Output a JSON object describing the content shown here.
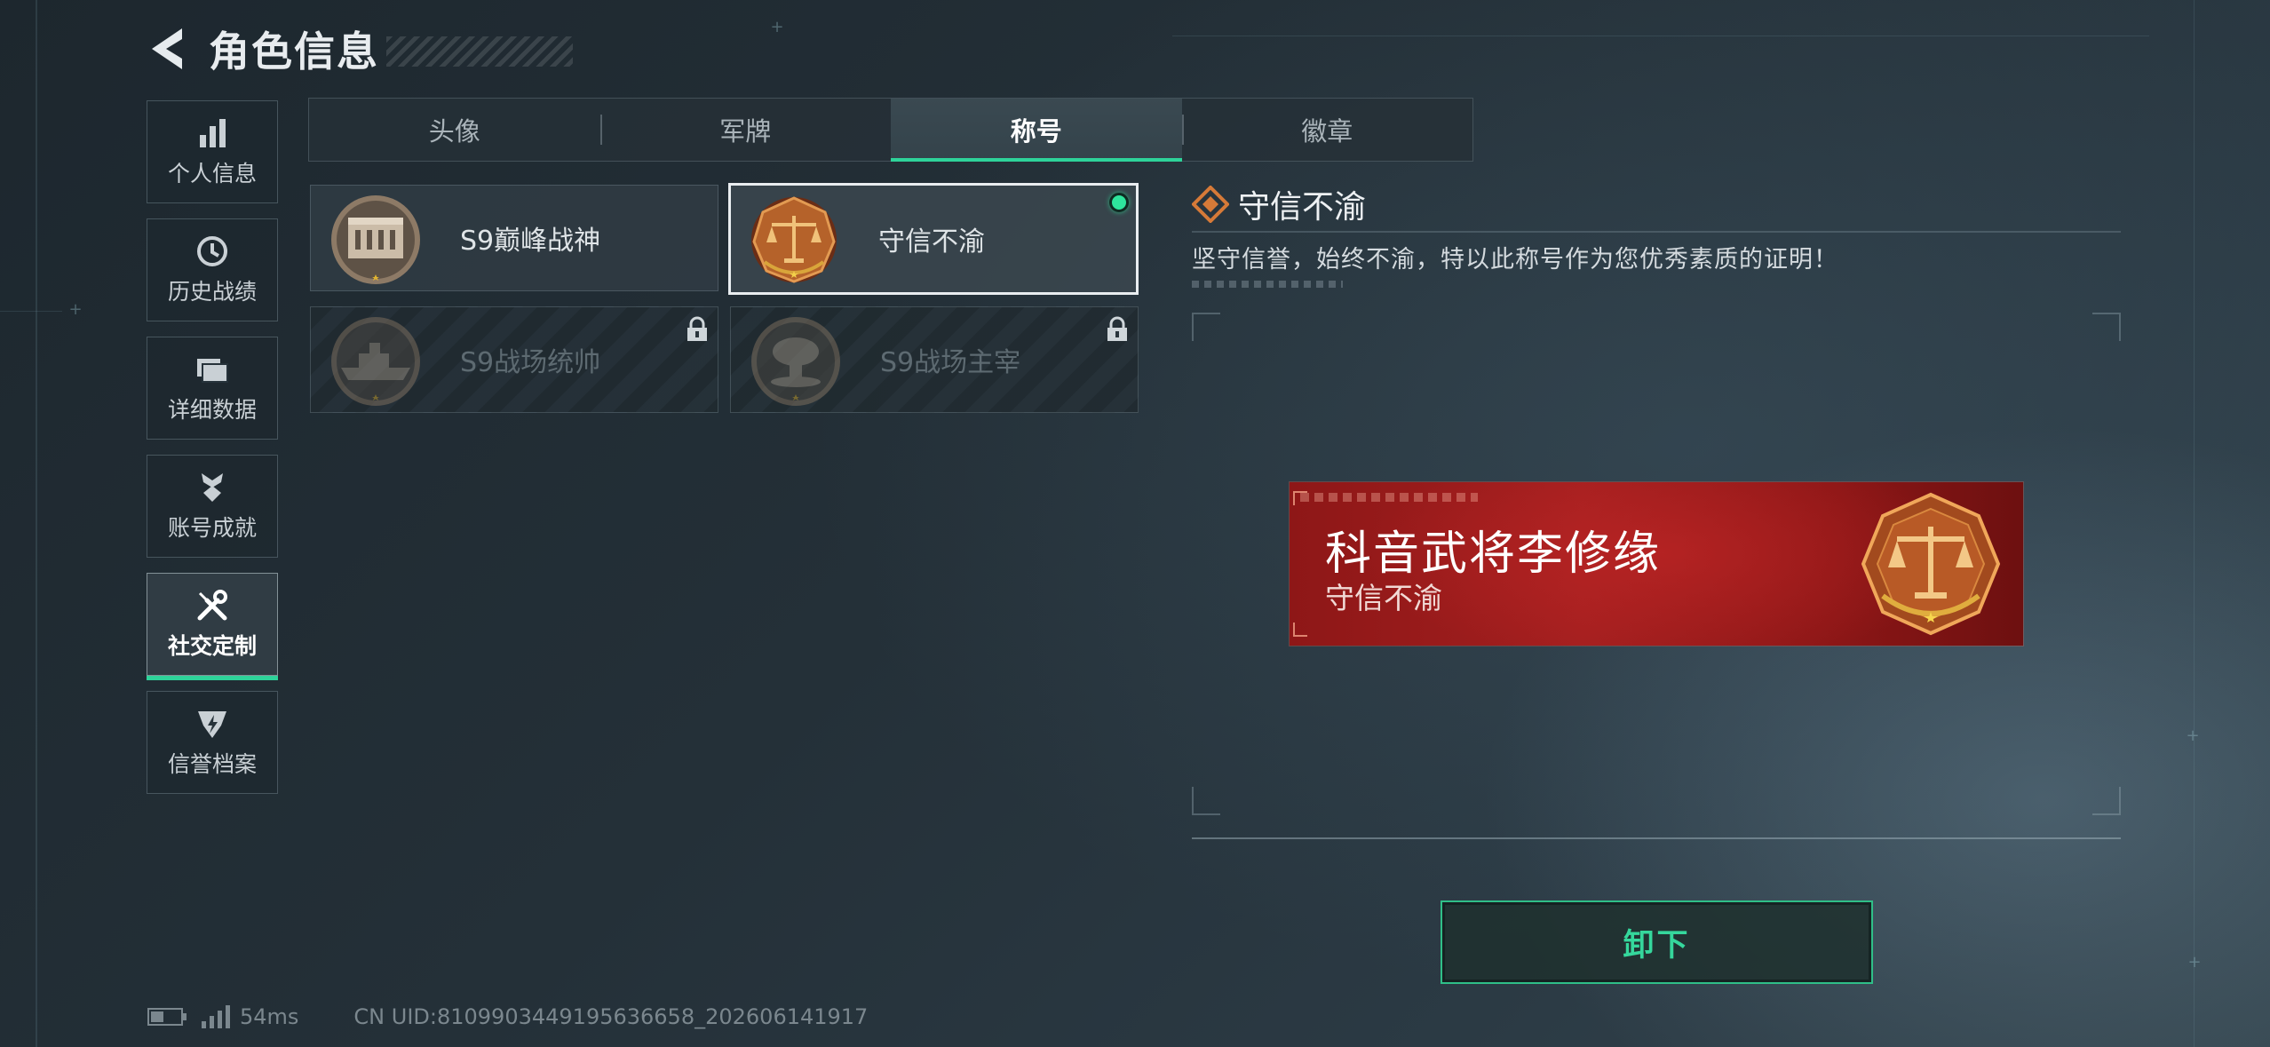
{
  "header": {
    "title": "角色信息"
  },
  "sidebar": {
    "items": [
      {
        "label": "个人信息",
        "icon": "bar-chart-icon"
      },
      {
        "label": "历史战绩",
        "icon": "history-clock-icon"
      },
      {
        "label": "详细数据",
        "icon": "folder-icon"
      },
      {
        "label": "账号成就",
        "icon": "achievement-medal-icon"
      },
      {
        "label": "社交定制",
        "icon": "tools-icon",
        "active": true
      },
      {
        "label": "信誉档案",
        "icon": "reputation-badge-icon"
      }
    ]
  },
  "tabs": [
    {
      "label": "头像"
    },
    {
      "label": "军牌"
    },
    {
      "label": "称号",
      "active": true
    },
    {
      "label": "徽章"
    }
  ],
  "titles": [
    {
      "name": "S9巅峰战神",
      "locked": false,
      "selected": false
    },
    {
      "name": "守信不渝",
      "locked": false,
      "selected": true,
      "equipped": true
    },
    {
      "name": "S9战场统帅",
      "locked": true,
      "selected": false
    },
    {
      "name": "S9战场主宰",
      "locked": true,
      "selected": false
    }
  ],
  "detail": {
    "title": "守信不渝",
    "description": "坚守信誉，始终不渝，特以此称号作为您优秀素质的证明！"
  },
  "nameplate": {
    "player_name": "科音武将李修缘",
    "title": "守信不渝"
  },
  "actions": {
    "unequip_label": "卸下"
  },
  "status_bar": {
    "ping": "54ms",
    "uid": "CN UID:810990344919563665​8_202606141917"
  },
  "colors": {
    "accent_green": "#2ed39a",
    "nameplate_red": "#a31f1f",
    "emblem_bronze": "#b5622a"
  }
}
